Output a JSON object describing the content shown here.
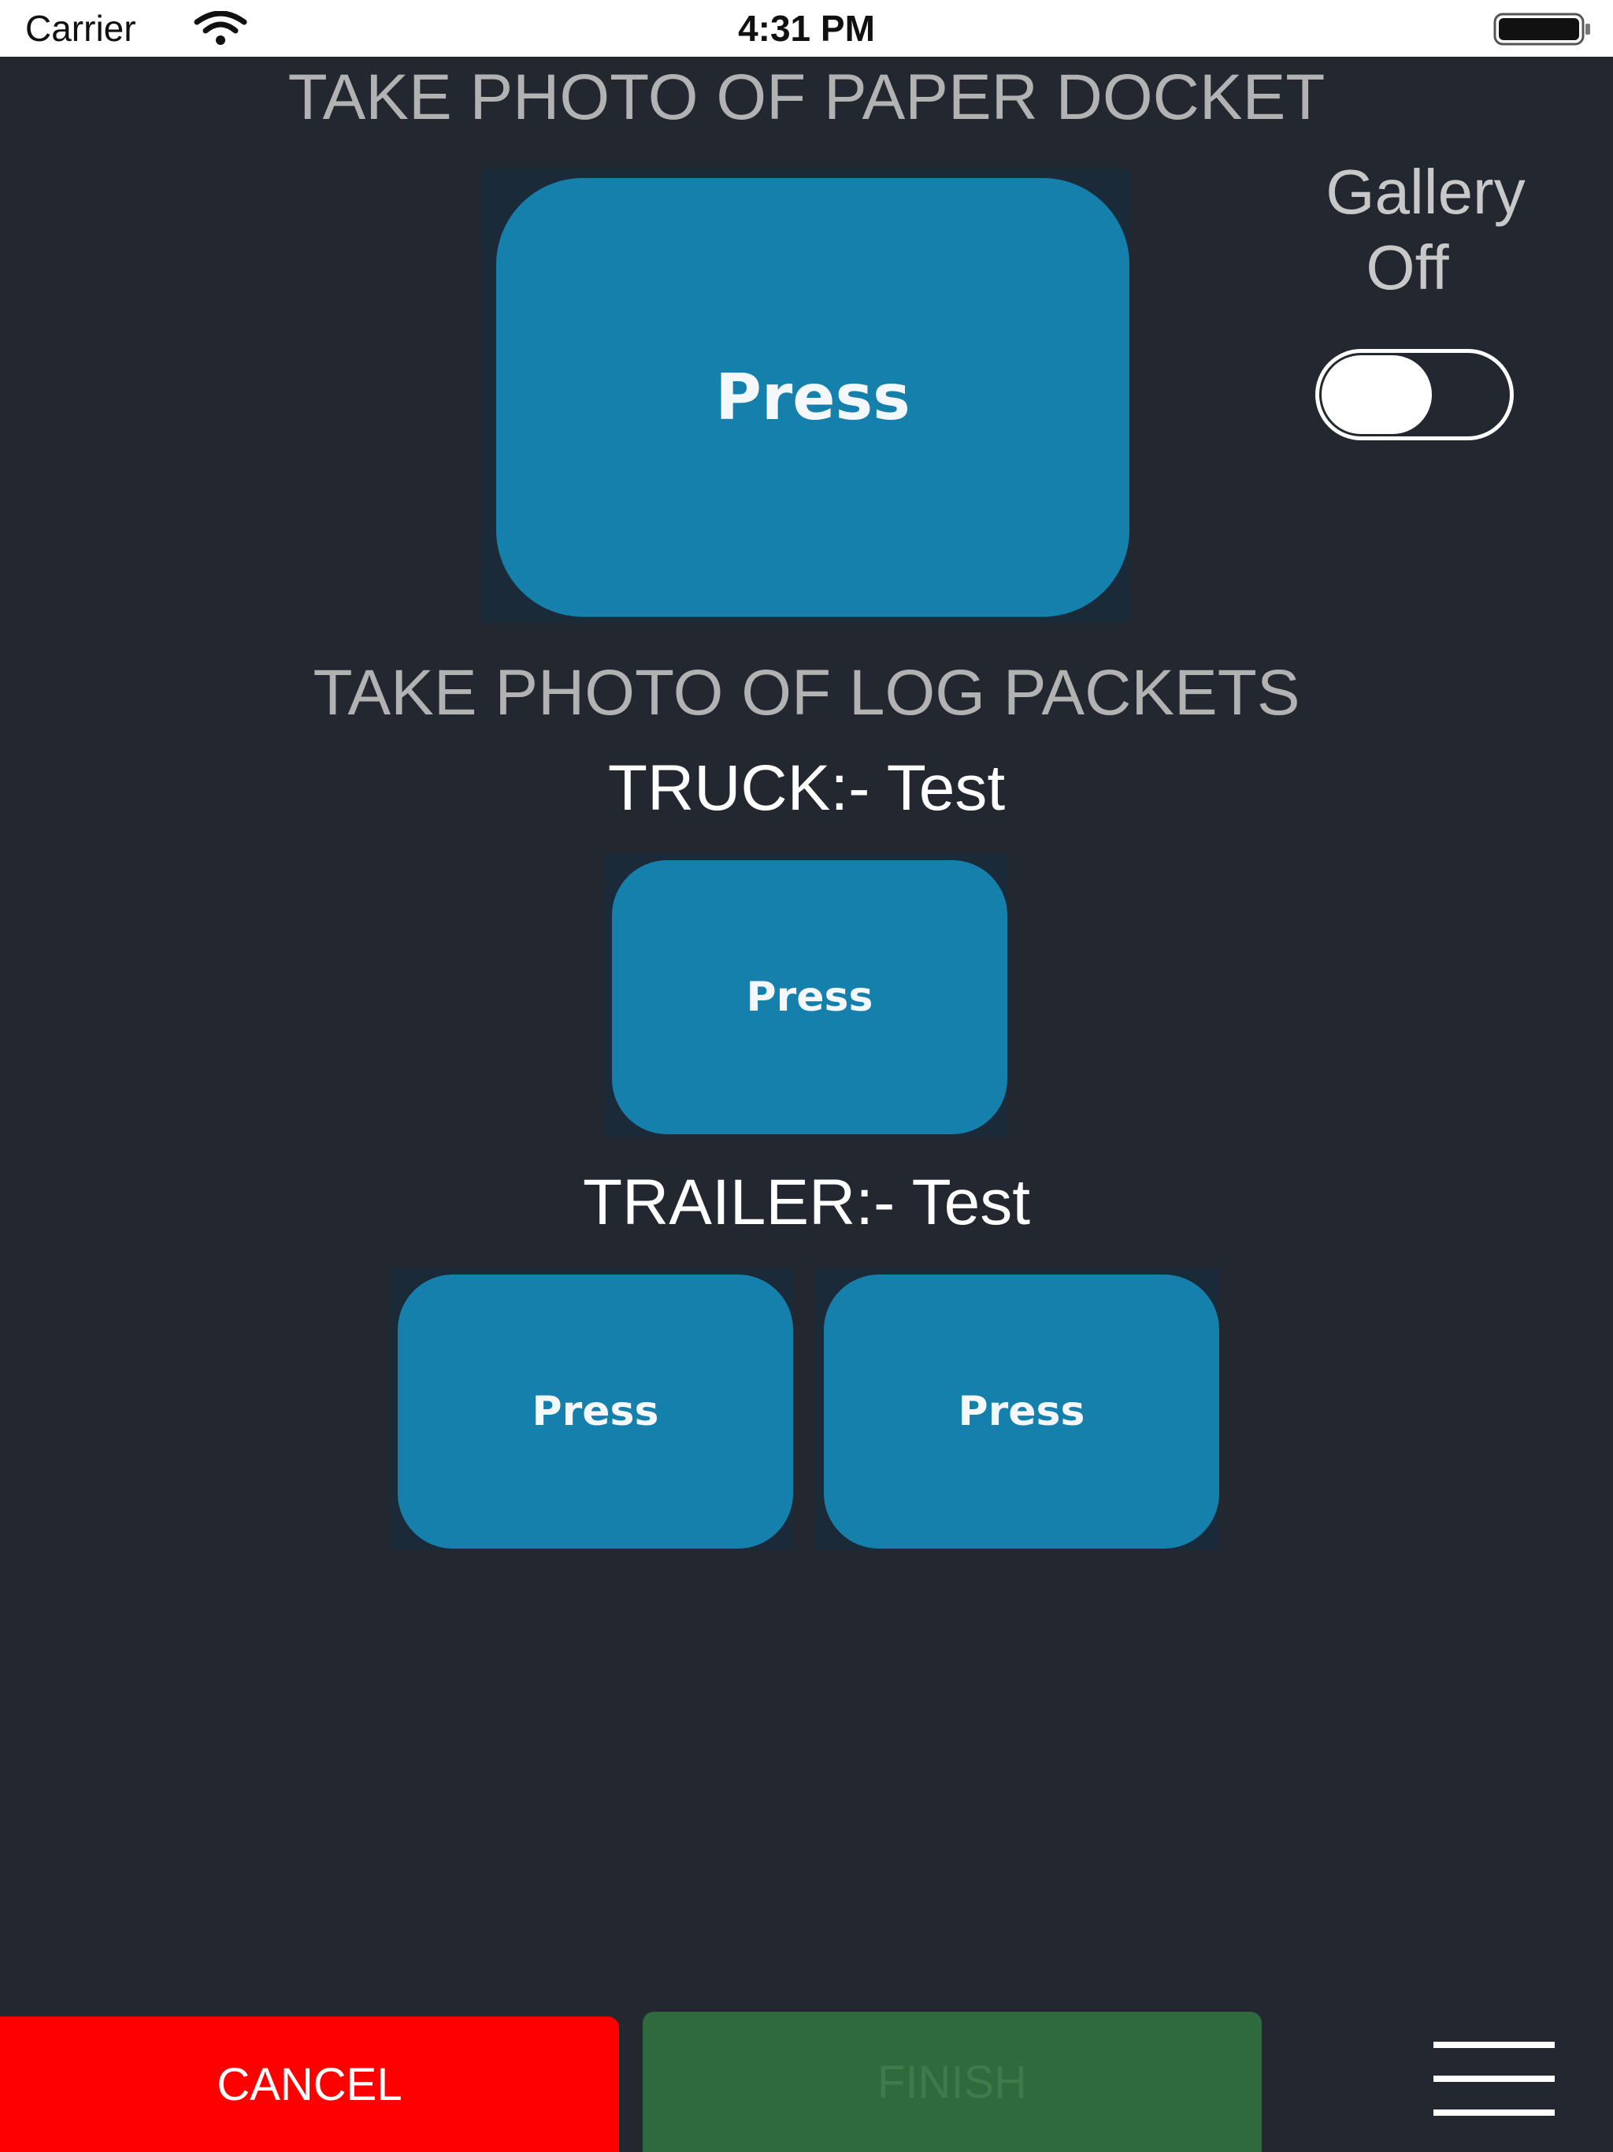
{
  "status_bar": {
    "carrier": "Carrier",
    "time": "4:31 PM",
    "wifi_icon": "wifi-icon",
    "battery_icon": "battery-icon"
  },
  "docket": {
    "title": "TAKE PHOTO OF PAPER DOCKET",
    "press_label": "Press"
  },
  "gallery": {
    "label_line1": "Gallery",
    "label_line2": "Off",
    "toggle_on": false
  },
  "packets": {
    "title": "TAKE PHOTO OF LOG PACKETS",
    "truck_label": "TRUCK:- Test",
    "truck_press_label": "Press",
    "trailer_label": "TRAILER:- Test",
    "trailer_press_labels": [
      "Press",
      "Press"
    ]
  },
  "footer": {
    "cancel_label": "CANCEL",
    "finish_label": "FINISH",
    "menu_icon": "hamburger-menu-icon"
  },
  "colors": {
    "background": "#222730",
    "press_button": "#1680ad",
    "cancel": "#ff0000",
    "finish": "#2e6a3e"
  }
}
